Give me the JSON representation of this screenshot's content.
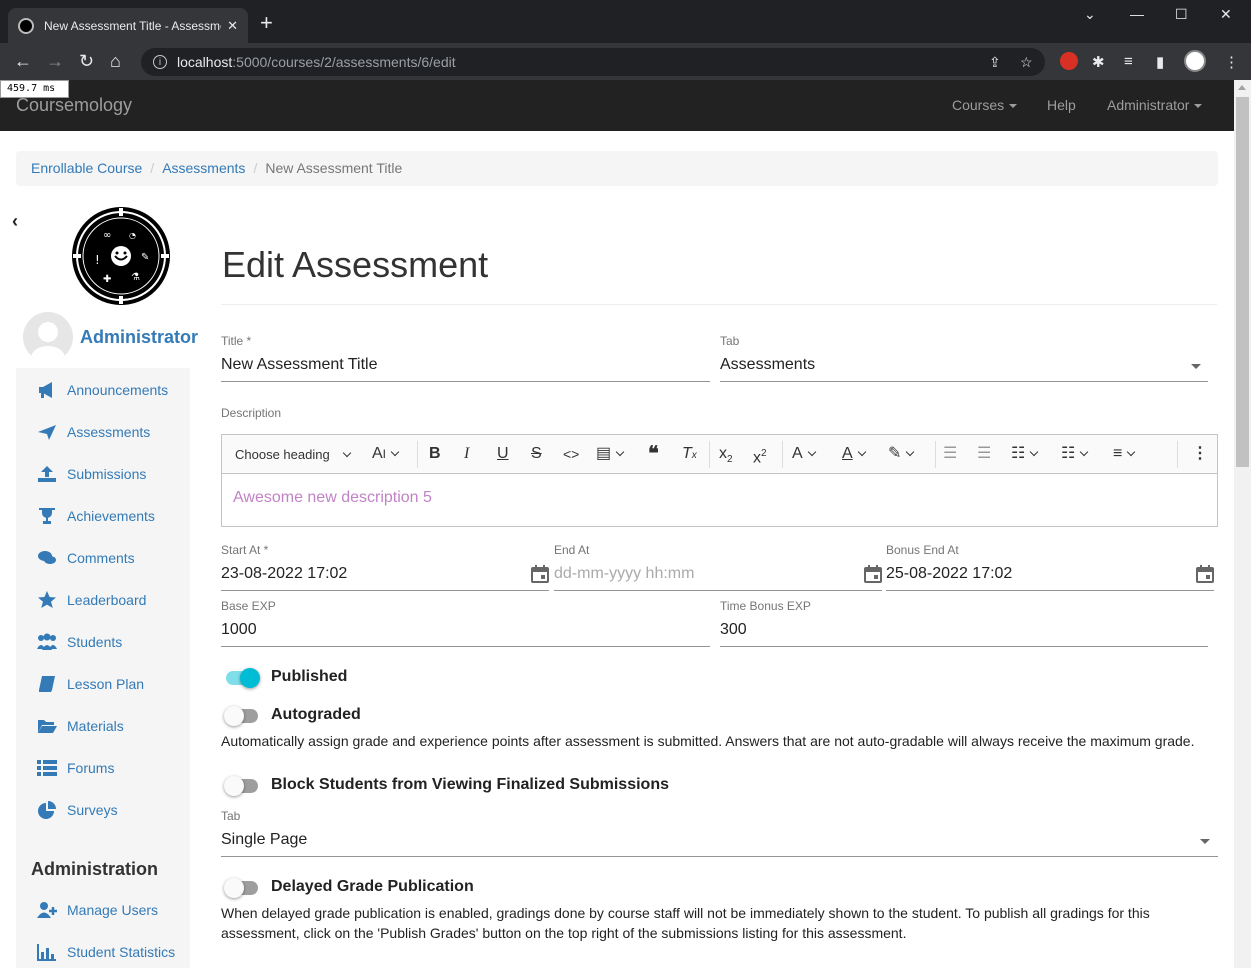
{
  "browser": {
    "tab_title": "New Assessment Title - Assessments",
    "url_host": "localhost",
    "url_path": ":5000/courses/2/assessments/6/edit",
    "timing": "459.7 ms"
  },
  "navbar": {
    "brand": "Coursemology",
    "courses": "Courses",
    "help": "Help",
    "administrator": "Administrator"
  },
  "breadcrumb": {
    "course": "Enrollable Course",
    "assessments": "Assessments",
    "current": "New Assessment Title"
  },
  "sidebar": {
    "user_name": "Administrator",
    "items": [
      {
        "label": "Announcements",
        "icon": "megaphone-icon"
      },
      {
        "label": "Assessments",
        "icon": "plane-icon"
      },
      {
        "label": "Submissions",
        "icon": "upload-icon"
      },
      {
        "label": "Achievements",
        "icon": "trophy-icon"
      },
      {
        "label": "Comments",
        "icon": "comments-icon"
      },
      {
        "label": "Leaderboard",
        "icon": "star-icon"
      },
      {
        "label": "Students",
        "icon": "users-icon"
      },
      {
        "label": "Lesson Plan",
        "icon": "book-icon"
      },
      {
        "label": "Materials",
        "icon": "folder-icon"
      },
      {
        "label": "Forums",
        "icon": "list-icon"
      },
      {
        "label": "Surveys",
        "icon": "pie-chart-icon"
      }
    ],
    "admin_heading": "Administration",
    "admin_items": [
      {
        "label": "Manage Users",
        "icon": "user-plus-icon"
      },
      {
        "label": "Student Statistics",
        "icon": "bar-chart-icon"
      }
    ]
  },
  "form": {
    "heading": "Edit Assessment",
    "title_label": "Title *",
    "title_value": "New Assessment Title",
    "tab_label": "Tab",
    "tab_value": "Assessments",
    "description_label": "Description",
    "heading_select": "Choose heading",
    "description_value": "Awesome new description 5",
    "start_label": "Start At *",
    "start_value": "23-08-2022 17:02",
    "end_label": "End At",
    "end_placeholder": "dd-mm-yyyy hh:mm",
    "bonus_label": "Bonus End At",
    "bonus_value": "25-08-2022 17:02",
    "base_exp_label": "Base EXP",
    "base_exp_value": "1000",
    "time_bonus_label": "Time Bonus EXP",
    "time_bonus_value": "300",
    "published_label": "Published",
    "published": true,
    "autograded_label": "Autograded",
    "autograded": false,
    "autograded_help": "Automatically assign grade and experience points after assessment is submitted. Answers that are not auto-gradable will always receive the maximum grade.",
    "block_label": "Block Students from Viewing Finalized Submissions",
    "block": false,
    "display_tab_label": "Tab",
    "display_tab_value": "Single Page",
    "delayed_label": "Delayed Grade Publication",
    "delayed": false,
    "delayed_help_1": "When delayed grade publication is enabled, gradings done by course staff will not be immediately shown to the student. To publish all gradings for this",
    "delayed_help_2": "assessment, click on the 'Publish Grades' button on the top right of the submissions listing for this assessment."
  },
  "colors": {
    "link": "#337ab7",
    "navbar_bg": "#222222",
    "toggle_on": "#00bcd4",
    "description_text": "#c183c6"
  }
}
